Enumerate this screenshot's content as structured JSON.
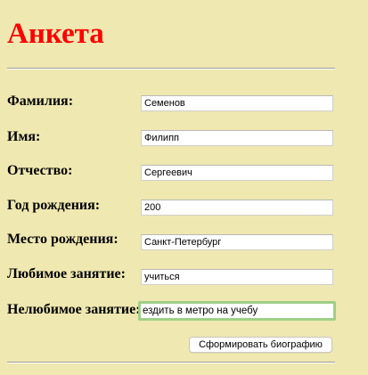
{
  "title": "Анкета",
  "form": {
    "fields": [
      {
        "label": "Фамилия:",
        "value": "Семенов"
      },
      {
        "label": "Имя:",
        "value": "Филипп"
      },
      {
        "label": "Отчество:",
        "value": "Сергеевич"
      },
      {
        "label": "Год рождения:",
        "value": "200"
      },
      {
        "label": "Место рождения:",
        "value": "Санкт-Петербург"
      },
      {
        "label": "Любимое занятие:",
        "value": "учиться"
      },
      {
        "label": "Нелюбимое занятие:",
        "value": "ездить в метро на учебу"
      }
    ],
    "submit_label": "Сформировать биографию"
  },
  "colors": {
    "background": "#efe8b0",
    "title": "#ff0000",
    "focus_ring": "#9fcf86"
  }
}
